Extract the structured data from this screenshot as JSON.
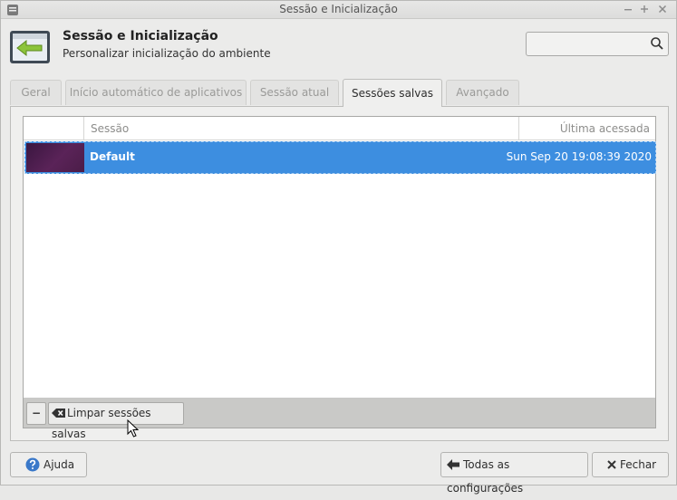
{
  "window": {
    "title": "Sessão e Inicialização",
    "controls": [
      "minimize",
      "maximize",
      "close"
    ]
  },
  "header": {
    "title": "Sessão e Inicialização",
    "subtitle": "Personalizar inicialização do ambiente",
    "search": {
      "value": "",
      "placeholder": ""
    }
  },
  "tabs": [
    {
      "label": "Geral",
      "active": false
    },
    {
      "label": "Início automático de aplicativos",
      "active": false
    },
    {
      "label": "Sessão atual",
      "active": false
    },
    {
      "label": "Sessões salvas",
      "active": true
    },
    {
      "label": "Avançado",
      "active": false
    }
  ],
  "sessions": {
    "columns": {
      "session": "Sessão",
      "last_accessed": "Última acessada"
    },
    "rows": [
      {
        "name": "Default",
        "last_accessed": "Sun Sep 20 19:08:39 2020",
        "selected": true
      }
    ],
    "toolbar": {
      "remove_label": "−",
      "clear_label": "Limpar sessões salvas"
    }
  },
  "footer": {
    "help_label": "Ajuda",
    "all_settings_label": "Todas as configurações",
    "close_label": "Fechar"
  },
  "colors": {
    "selection": "#3d8ee0",
    "window_bg": "#ebebea"
  }
}
